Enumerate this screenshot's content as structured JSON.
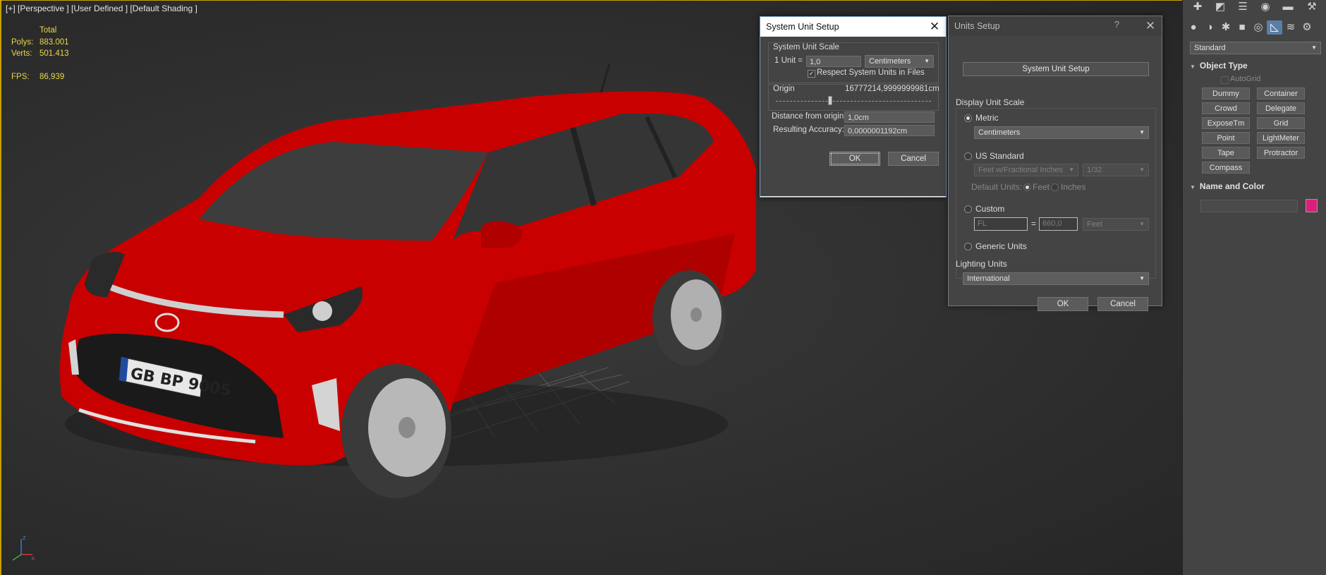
{
  "viewport": {
    "label": "[+] [Perspective ] [User Defined ] [Default Shading ]",
    "stats": {
      "header": "Total",
      "polys_label": "Polys:",
      "polys": "883.001",
      "verts_label": "Verts:",
      "verts": "501.413",
      "fps_label": "FPS:",
      "fps": "86,939"
    },
    "plate": "GB BP 9005"
  },
  "system_unit_setup": {
    "title": "System Unit Setup",
    "group_label": "System Unit Scale",
    "unit_label": "1 Unit =",
    "unit_value": "1,0",
    "unit_type": "Centimeters",
    "respect_label": "Respect System Units in Files",
    "respect_checked": true,
    "origin_label": "Origin",
    "origin_value": "16777214,9999999981cm",
    "distance_label": "Distance from origin:",
    "distance_value": "1,0cm",
    "accuracy_label": "Resulting Accuracy:",
    "accuracy_value": "0,0000001192cm",
    "ok": "OK",
    "cancel": "Cancel"
  },
  "units_setup": {
    "title": "Units Setup",
    "help": "?",
    "system_button": "System Unit Setup",
    "display_scale_label": "Display Unit Scale",
    "metric_label": "Metric",
    "metric_value": "Centimeters",
    "us_label": "US Standard",
    "us_value": "Feet w/Fractional Inches",
    "us_fraction": "1/32",
    "default_units_label": "Default Units:",
    "feet_label": "Feet",
    "inches_label": "Inches",
    "custom_label": "Custom",
    "custom_name": "FL",
    "custom_eq": "=",
    "custom_value": "660,0",
    "custom_unit": "Feet",
    "generic_label": "Generic Units",
    "lighting_label": "Lighting Units",
    "lighting_value": "International",
    "ok": "OK",
    "cancel": "Cancel"
  },
  "command_panel": {
    "category": "Standard",
    "object_type_label": "Object Type",
    "autogrid_label": "AutoGrid",
    "buttons": [
      "Dummy",
      "Container",
      "Crowd",
      "Delegate",
      "ExposeTm",
      "Grid",
      "Point",
      "LightMeter",
      "Tape",
      "Protractor",
      "Compass"
    ],
    "name_color_label": "Name and Color",
    "color": "#d9207a"
  }
}
